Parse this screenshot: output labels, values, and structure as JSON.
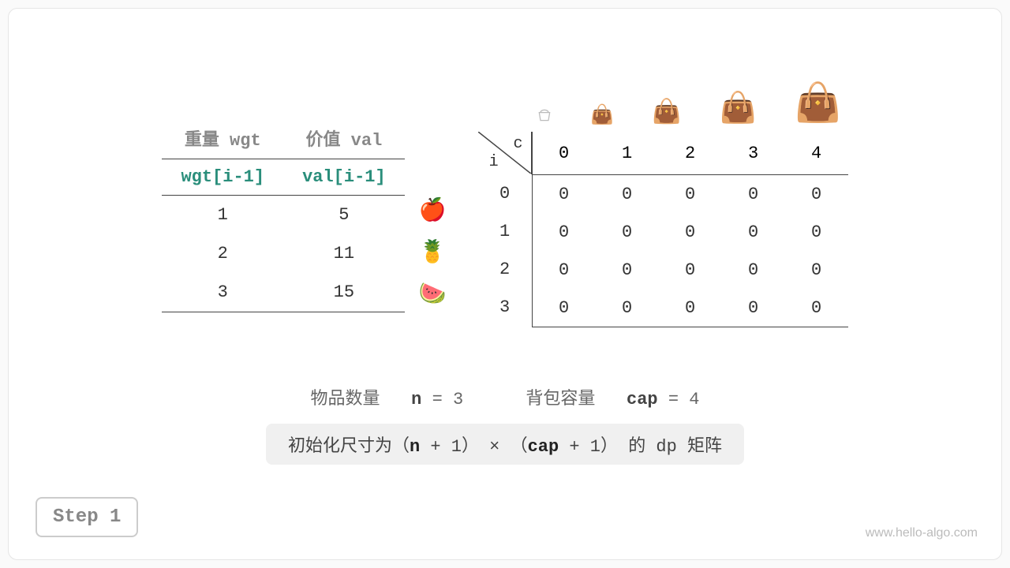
{
  "items_table": {
    "headers": {
      "wgt": "重量 wgt",
      "val": "价值 val"
    },
    "subheaders": {
      "wgt": "wgt[i-1]",
      "val": "val[i-1]"
    },
    "rows": [
      {
        "wgt": "1",
        "val": "5",
        "fruit": "🍎"
      },
      {
        "wgt": "2",
        "val": "11",
        "fruit": "🍍"
      },
      {
        "wgt": "3",
        "val": "15",
        "fruit": "🍉"
      }
    ]
  },
  "dp": {
    "labels": {
      "i": "i",
      "c": "c"
    },
    "col_headers": [
      "0",
      "1",
      "2",
      "3",
      "4"
    ],
    "rows": [
      {
        "idx": "0",
        "cells": [
          {
            "v": "0",
            "f": false
          },
          {
            "v": "0",
            "f": false
          },
          {
            "v": "0",
            "f": false
          },
          {
            "v": "0",
            "f": false
          },
          {
            "v": "0",
            "f": false
          }
        ]
      },
      {
        "idx": "1",
        "cells": [
          {
            "v": "0",
            "f": false
          },
          {
            "v": "0",
            "f": true
          },
          {
            "v": "0",
            "f": true
          },
          {
            "v": "0",
            "f": true
          },
          {
            "v": "0",
            "f": true
          }
        ]
      },
      {
        "idx": "2",
        "cells": [
          {
            "v": "0",
            "f": false
          },
          {
            "v": "0",
            "f": true
          },
          {
            "v": "0",
            "f": true
          },
          {
            "v": "0",
            "f": true
          },
          {
            "v": "0",
            "f": true
          }
        ]
      },
      {
        "idx": "3",
        "cells": [
          {
            "v": "0",
            "f": false
          },
          {
            "v": "0",
            "f": true
          },
          {
            "v": "0",
            "f": true
          },
          {
            "v": "0",
            "f": true
          },
          {
            "v": "0",
            "f": true
          }
        ]
      }
    ]
  },
  "params": {
    "items_label": "物品数量",
    "n_sym": "n",
    "n_val": "3",
    "cap_label": "背包容量",
    "cap_sym": "cap",
    "cap_val": "4"
  },
  "init_text": {
    "p1": "初始化尺寸为（",
    "n": "n",
    "p2": " + 1） × （",
    "cap": "cap",
    "p3": " + 1） 的 dp 矩阵"
  },
  "step": "Step 1",
  "site": "www.hello-algo.com"
}
